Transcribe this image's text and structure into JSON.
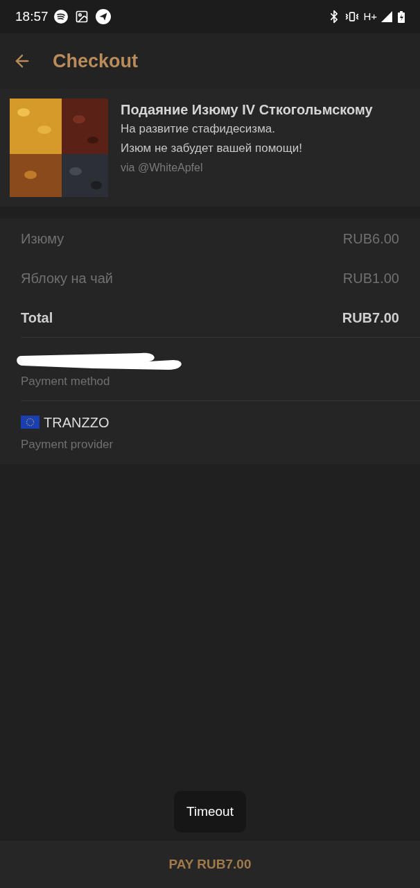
{
  "status_bar": {
    "time": "18:57",
    "network": "H+"
  },
  "app_bar": {
    "title": "Checkout"
  },
  "product": {
    "image": {
      "kind": "picture"
    },
    "title": "Подаяние Изюму IV Сткогольмскому",
    "description": [
      "На развитие стафидесизма.",
      "Изюм не забудет вашей помощи!"
    ],
    "via": "via @WhiteApfel"
  },
  "prices": [
    {
      "label": "Изюму",
      "amount": "RUB6.00",
      "kind": "item"
    },
    {
      "label": "Яблоку на чай",
      "amount": "RUB1.00",
      "kind": "item"
    },
    {
      "label": "Total",
      "amount": "RUB7.00",
      "kind": "total"
    }
  ],
  "payment_method": {
    "label": "Payment method"
  },
  "payment_provider": {
    "name": "TRANZZO",
    "label": "Payment provider"
  },
  "toast": {
    "text": "Timeout"
  },
  "pay_button": {
    "label": "PAY RUB7.00"
  }
}
